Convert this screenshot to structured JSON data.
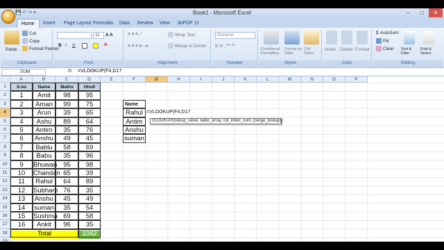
{
  "window": {
    "title": "Book1 - Microsoft Excel"
  },
  "tabs": [
    "Home",
    "Insert",
    "Page Layout",
    "Formulas",
    "Data",
    "Review",
    "View",
    "doPDF 11"
  ],
  "ribbon": {
    "clipboard": {
      "paste": "Paste",
      "cut": "Cut",
      "copy": "Copy",
      "format_painter": "Format Painter",
      "label": "Clipboard"
    },
    "font": {
      "name": "",
      "size": "11",
      "label": "Font"
    },
    "alignment": {
      "wrap": "Wrap Text",
      "merge": "Merge & Center",
      "label": "Alignment"
    },
    "number": {
      "format": "General",
      "label": "Number"
    },
    "styles": {
      "conditional": "Conditional Formatting",
      "format_table": "Format as Table",
      "cell_styles": "Cell Styles",
      "label": "Styles"
    },
    "cells": {
      "insert": "Insert",
      "delete": "Delete",
      "format": "Format",
      "label": "Cells"
    },
    "editing": {
      "autosum": "AutoSum",
      "fill": "Fill",
      "clear": "Clear",
      "sort": "Sort & Filter",
      "find": "Find & Select",
      "label": "Editing"
    }
  },
  "formula_bar": {
    "name_box": "SUM",
    "fx": "fx",
    "formula": "=VLOOKUP(F4,D17"
  },
  "columns": [
    "A",
    "B",
    "C",
    "D",
    "E",
    "F",
    "G",
    "H",
    "I",
    "J",
    "K",
    "L",
    "M",
    "N",
    "O",
    "P"
  ],
  "rows": [
    "1",
    "2",
    "3",
    "4",
    "5",
    "6",
    "7",
    "8",
    "9",
    "10",
    "11",
    "12",
    "13",
    "14",
    "15",
    "16",
    "17",
    "18",
    "19"
  ],
  "table": {
    "headers": [
      "S.no",
      "Name",
      "Maths",
      "Hindi"
    ],
    "rows": [
      [
        "1",
        "Amit",
        "98",
        "95"
      ],
      [
        "2",
        "Aman",
        "99",
        "75"
      ],
      [
        "3",
        "Arun",
        "39",
        "65"
      ],
      [
        "4",
        "Ashu",
        "89",
        "64"
      ],
      [
        "5",
        "Antim",
        "35",
        "76"
      ],
      [
        "6",
        "Anshu",
        "49",
        "45"
      ],
      [
        "7",
        "Bablu",
        "58",
        "69"
      ],
      [
        "8",
        "Babu",
        "35",
        "96"
      ],
      [
        "9",
        "Bhuwan",
        "95",
        "98"
      ],
      [
        "10",
        "Chandan",
        "65",
        "39"
      ],
      [
        "11",
        "Rahul",
        "64",
        "89"
      ],
      [
        "12",
        "Subham",
        "76",
        "35"
      ],
      [
        "13",
        "Anshu",
        "45",
        "49"
      ],
      [
        "14",
        "suman",
        "35",
        "54"
      ],
      [
        "15",
        "Sushma",
        "69",
        "58"
      ],
      [
        "16",
        "Ankit",
        "96",
        "35"
      ]
    ],
    "total_label": "Total",
    "total_value": "1042"
  },
  "lookup": {
    "header": "Name",
    "names": [
      "Rahul",
      "Antim",
      "Anshu",
      "suman"
    ],
    "editing": "=VLOOKUP(F4,D17"
  },
  "tooltip": "VLOOKUP(lookup_value, table_array, col_index_num, [range_lookup])"
}
